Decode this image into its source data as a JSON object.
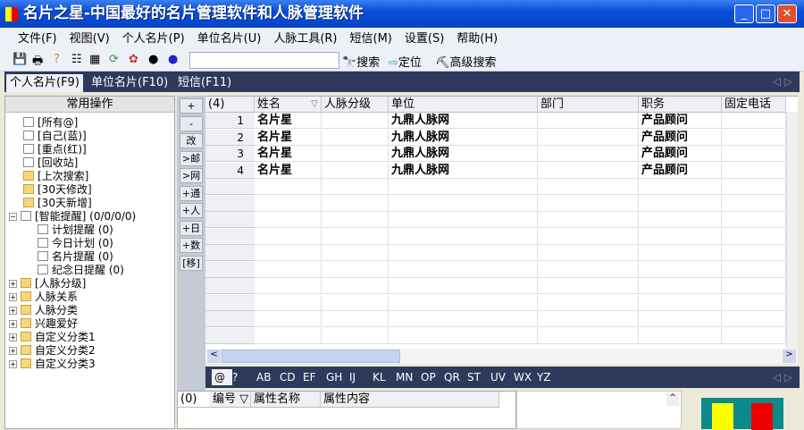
{
  "window": {
    "title": "名片之星-中国最好的名片管理软件和人脉管理软件"
  },
  "menu": [
    "文件(F)",
    "视图(V)",
    "个人名片(P)",
    "单位名片(U)",
    "人脉工具(R)",
    "短信(M)",
    "设置(S)",
    "帮助(H)"
  ],
  "toolbar": {
    "search_value": "",
    "search": "搜索",
    "locate": "定位",
    "advanced": "高级搜索"
  },
  "tabs": [
    "个人名片(F9)",
    "单位名片(F10)",
    "短信(F11)"
  ],
  "left": {
    "header": "常用操作",
    "items": [
      {
        "label": "[所有@]",
        "indent": 1,
        "pm": ""
      },
      {
        "label": "[自己(蓝)]",
        "indent": 1,
        "pm": ""
      },
      {
        "label": "[重点(红)]",
        "indent": 1,
        "pm": ""
      },
      {
        "label": "[回收站]",
        "indent": 1,
        "pm": ""
      },
      {
        "label": "[上次搜索]",
        "indent": 1,
        "pm": ""
      },
      {
        "label": "[30天修改]",
        "indent": 1,
        "pm": ""
      },
      {
        "label": "[30天新增]",
        "indent": 1,
        "pm": ""
      },
      {
        "label": "[智能提醒] (0/0/0/0)",
        "indent": 0,
        "pm": "−"
      },
      {
        "label": "计划提醒 (0)",
        "indent": 2,
        "pm": ""
      },
      {
        "label": "今日计划 (0)",
        "indent": 2,
        "pm": ""
      },
      {
        "label": "名片提醒 (0)",
        "indent": 2,
        "pm": ""
      },
      {
        "label": "纪念日提醒 (0)",
        "indent": 2,
        "pm": ""
      },
      {
        "label": "[人脉分级]",
        "indent": 0,
        "pm": "+"
      },
      {
        "label": "人脉关系",
        "indent": 0,
        "pm": "+"
      },
      {
        "label": "人脉分类",
        "indent": 0,
        "pm": "+"
      },
      {
        "label": "兴趣爱好",
        "indent": 0,
        "pm": "+"
      },
      {
        "label": "自定义分类1",
        "indent": 0,
        "pm": "+"
      },
      {
        "label": "自定义分类2",
        "indent": 0,
        "pm": "+"
      },
      {
        "label": "自定义分类3",
        "indent": 0,
        "pm": "+"
      }
    ]
  },
  "side_buttons": [
    "+",
    "-",
    "改",
    ">邮",
    ">网",
    "+通",
    "+人",
    "+日",
    "+数",
    "[移]"
  ],
  "grid": {
    "count": "(4)",
    "columns": [
      "姓名",
      "人脉分级",
      "单位",
      "部门",
      "职务",
      "固定电话"
    ],
    "rows": [
      {
        "n": "1",
        "name": "名片星",
        "level": "",
        "company": "九鼎人脉网",
        "dept": "",
        "title": "产品顾问",
        "phone": ""
      },
      {
        "n": "2",
        "name": "名片星",
        "level": "",
        "company": "九鼎人脉网",
        "dept": "",
        "title": "产品顾问",
        "phone": ""
      },
      {
        "n": "3",
        "name": "名片星",
        "level": "",
        "company": "九鼎人脉网",
        "dept": "",
        "title": "产品顾问",
        "phone": ""
      },
      {
        "n": "4",
        "name": "名片星",
        "level": "",
        "company": "九鼎人脉网",
        "dept": "",
        "title": "产品顾问",
        "phone": ""
      }
    ]
  },
  "alpha": [
    "@",
    "?",
    "AB",
    "CD",
    "EF",
    "GH",
    "IJ",
    "KL",
    "MN",
    "OP",
    "QR",
    "ST",
    "UV",
    "WX",
    "YZ"
  ],
  "props": {
    "count": "(0)",
    "columns": [
      "编号",
      "属性名称",
      "属性内容"
    ]
  }
}
